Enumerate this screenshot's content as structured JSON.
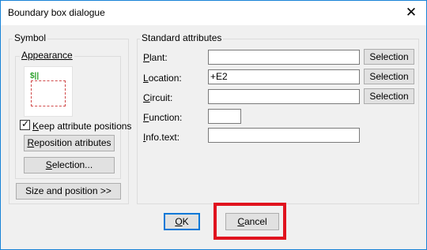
{
  "window": {
    "title": "Boundary box dialogue",
    "close_glyph": "✕"
  },
  "symbol": {
    "legend": "Symbol",
    "appearance_legend": "Appearance",
    "preview_mark": "$||",
    "keep_positions_pre": "K",
    "keep_positions_rest": "eep attribute positions",
    "keep_positions_checked": true,
    "reposition_pre": "R",
    "reposition_rest": "eposition atributes",
    "selection_pre": "S",
    "selection_rest": "election...",
    "size_position": "Size and position >>"
  },
  "attributes": {
    "legend": "Standard attributes",
    "plant": {
      "label_pre": "P",
      "label_rest": "lant:",
      "value": "",
      "button": "Selection"
    },
    "location": {
      "label_pre": "L",
      "label_rest": "ocation:",
      "value": "+E2",
      "button": "Selection"
    },
    "circuit": {
      "label_pre": "C",
      "label_rest": "ircuit:",
      "value": "",
      "button": "Selection"
    },
    "function": {
      "label_pre": "F",
      "label_rest": "unction:",
      "value": ""
    },
    "info": {
      "label_pre": "I",
      "label_rest": "nfo.text:",
      "value": ""
    }
  },
  "footer": {
    "ok_pre": "O",
    "ok_rest": "K",
    "cancel_pre": "C",
    "cancel_rest": "ancel"
  },
  "colors": {
    "accent": "#0078d7",
    "highlight": "#e0131e"
  }
}
